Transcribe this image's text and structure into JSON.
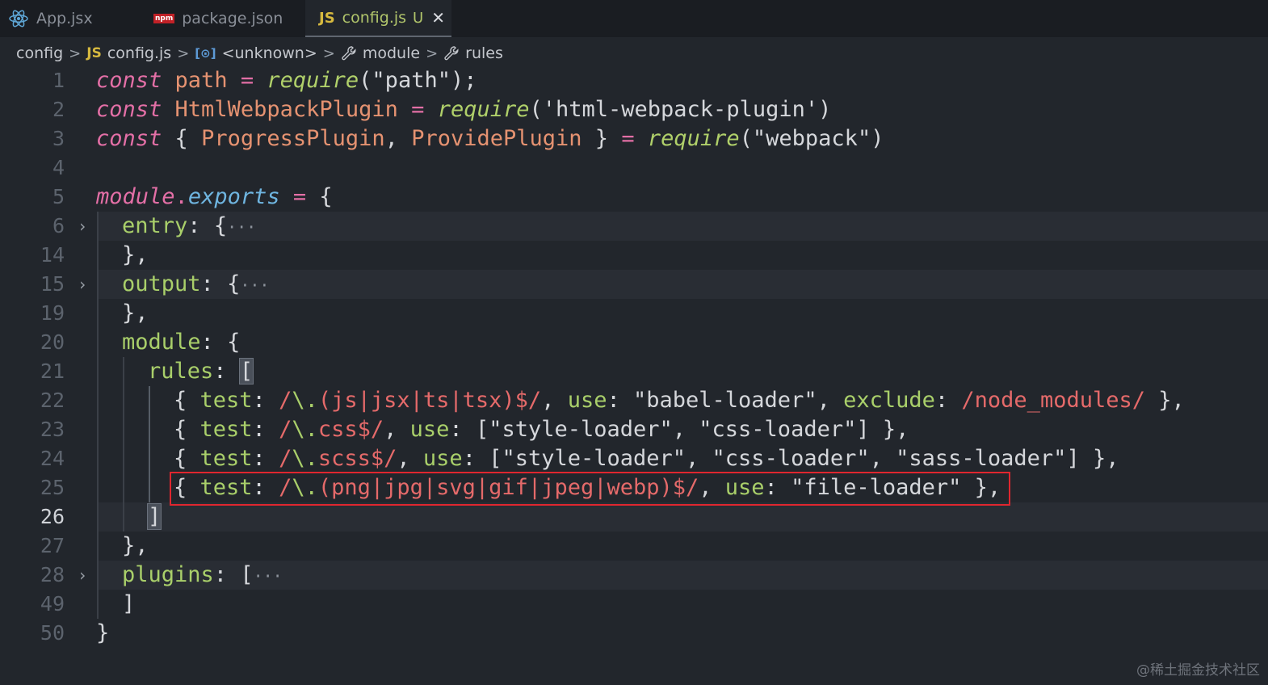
{
  "tabs": [
    {
      "label": "App.jsx",
      "icon": "react-icon",
      "active": false
    },
    {
      "label": "package.json",
      "icon": "npm-icon",
      "badge": "npm",
      "active": false
    },
    {
      "label": "config.js",
      "icon": "js-icon",
      "badge": "JS",
      "status": "U",
      "close": "✕",
      "active": true
    }
  ],
  "breadcrumb": {
    "folder": "config",
    "file_badge": "JS",
    "file": "config.js",
    "symbol1_icon": "[⊙]",
    "symbol1": "<unknown>",
    "symbol2": "module",
    "symbol3": "rules",
    "separator": ">"
  },
  "lines": [
    {
      "n": "1"
    },
    {
      "n": "2"
    },
    {
      "n": "3"
    },
    {
      "n": "4"
    },
    {
      "n": "5"
    },
    {
      "n": "6"
    },
    {
      "n": "14"
    },
    {
      "n": "15"
    },
    {
      "n": "19"
    },
    {
      "n": "20"
    },
    {
      "n": "21"
    },
    {
      "n": "22"
    },
    {
      "n": "23"
    },
    {
      "n": "24"
    },
    {
      "n": "25"
    },
    {
      "n": "26"
    },
    {
      "n": "27"
    },
    {
      "n": "28"
    },
    {
      "n": "49"
    },
    {
      "n": "50"
    }
  ],
  "code": {
    "l1": {
      "kw": "const",
      "name": "path",
      "eq": "=",
      "fn": "require",
      "arg": "(\"path\");"
    },
    "l2": {
      "kw": "const",
      "name": "HtmlWebpackPlugin",
      "eq": "=",
      "fn": "require",
      "arg": "('html-webpack-plugin')"
    },
    "l3": {
      "kw": "const",
      "open": "{",
      "a": "ProgressPlugin",
      "comma": ",",
      "b": "ProvidePlugin",
      "close": "}",
      "eq": "=",
      "fn": "require",
      "arg": "(\"webpack\")"
    },
    "l5": {
      "obj": "module",
      "dot": ".",
      "prop": "exports",
      "eq": "=",
      "open": "{"
    },
    "l6": {
      "key": "entry",
      "colon": ":",
      "open": "{",
      "ellipsis": "···"
    },
    "l14": {
      "text": "},"
    },
    "l15": {
      "key": "output",
      "colon": ":",
      "open": "{",
      "ellipsis": "···"
    },
    "l19": {
      "text": "},"
    },
    "l20": {
      "key": "module",
      "colon": ":",
      "open": "{"
    },
    "l21": {
      "key": "rules",
      "colon": ":",
      "open": "["
    },
    "l22": {
      "pre": "{ ",
      "k1": "test",
      "c1": ": ",
      "rx_open": "/",
      "rx_esc": "\\.",
      "rx_body": "(js|jsx|ts|tsx)$/",
      "mid": ", ",
      "k2": "use",
      "c2": ": ",
      "val": "\"babel-loader\"",
      "mid2": ", ",
      "k3": "exclude",
      "c3": ": ",
      "rx2": "/node_modules/",
      "post": " },"
    },
    "l23": {
      "pre": "{ ",
      "k1": "test",
      "c1": ": ",
      "rx_open": "/",
      "rx_esc": "\\.",
      "rx_body": "css$/",
      "mid": ", ",
      "k2": "use",
      "c2": ": ",
      "val": "[\"style-loader\", \"css-loader\"]",
      "post": " },"
    },
    "l24": {
      "pre": "{ ",
      "k1": "test",
      "c1": ": ",
      "rx_open": "/",
      "rx_esc": "\\.",
      "rx_body": "scss$/",
      "mid": ", ",
      "k2": "use",
      "c2": ": ",
      "val": "[\"style-loader\", \"css-loader\", \"sass-loader\"]",
      "post": " },"
    },
    "l25": {
      "pre": "{ ",
      "k1": "test",
      "c1": ": ",
      "rx_open": "/",
      "rx_esc": "\\.",
      "rx_body": "(png|jpg|svg|gif|jpeg|webp)$/",
      "mid": ", ",
      "k2": "use",
      "c2": ": ",
      "val": "\"file-loader\"",
      "post": " },"
    },
    "l26": {
      "close": "]"
    },
    "l27": {
      "text": "},"
    },
    "l28": {
      "key": "plugins",
      "colon": ":",
      "open": "[",
      "ellipsis": "···"
    },
    "l49": {
      "text": "]"
    },
    "l50": {
      "text": "}"
    }
  },
  "watermark": "@稀土掘金技术社区",
  "colors": {
    "highlight_box": "#e0262f",
    "keyword": "#e36fa6",
    "function": "#b0d06a",
    "regex": "#e56a6a"
  }
}
